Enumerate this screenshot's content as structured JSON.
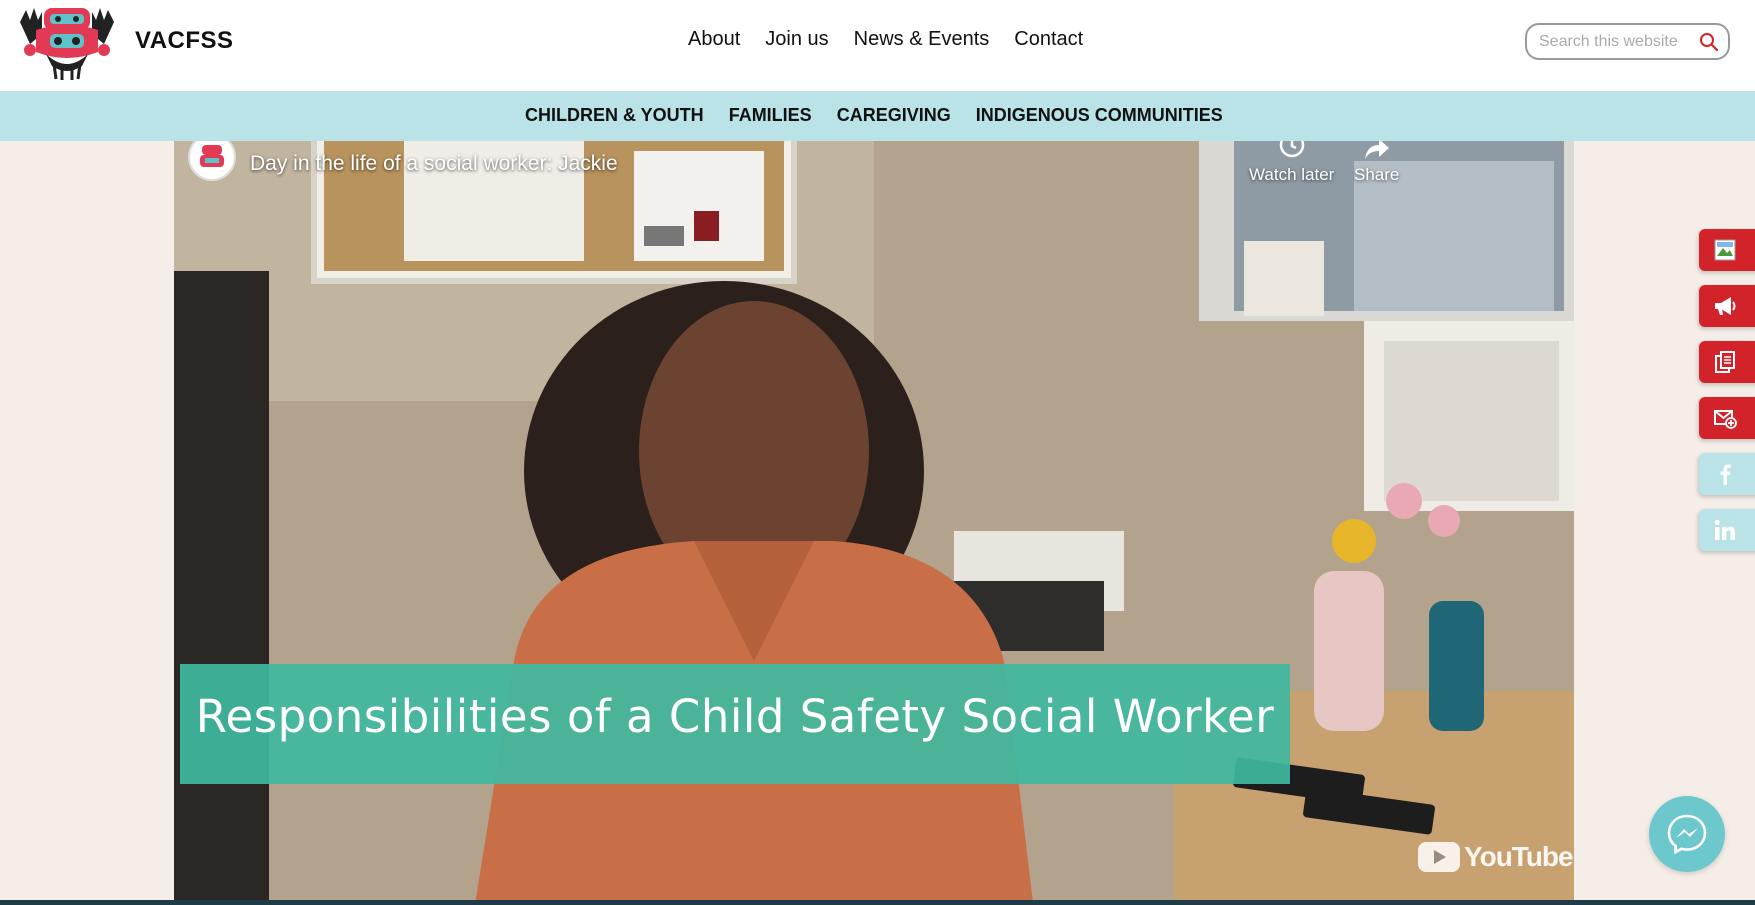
{
  "site": {
    "brand": "VACFSS",
    "logo_icon": "totem-logo-icon"
  },
  "main_nav": [
    "About",
    "Join us",
    "News & Events",
    "Contact"
  ],
  "search": {
    "placeholder": "Search this website",
    "icon": "search-icon"
  },
  "sub_nav": [
    "CHILDREN & YOUTH",
    "FAMILIES",
    "CAREGIVING",
    "INDIGENOUS COMMUNITIES"
  ],
  "video": {
    "title": "Day in the life of a social worker: Jackie",
    "watch_later": "Watch later",
    "share": "Share",
    "caption": "Responsibilities of a Child Safety Social Worker",
    "platform": "YouTube"
  },
  "side_tabs": [
    {
      "icon": "broken-image-icon",
      "style": "red"
    },
    {
      "icon": "megaphone-icon",
      "style": "red"
    },
    {
      "icon": "documents-icon",
      "style": "red"
    },
    {
      "icon": "mail-add-icon",
      "style": "red"
    },
    {
      "icon": "facebook-icon",
      "style": "teal"
    },
    {
      "icon": "linkedin-icon",
      "style": "teal"
    }
  ],
  "messenger": {
    "icon": "messenger-icon"
  },
  "colors": {
    "accent_red": "#d2232a",
    "subnav_teal": "#b9e3e7",
    "caption_green": "#3fb9a0",
    "page_bg": "#f5ede7"
  }
}
